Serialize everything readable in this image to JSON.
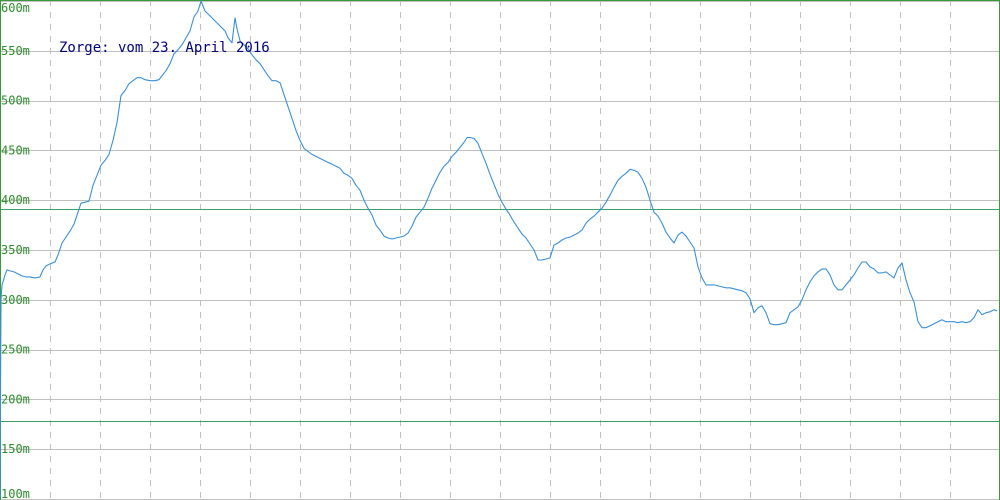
{
  "colors": {
    "background": "#ffffff",
    "grid": "#c0c0c0",
    "frame": "#3a9a3a",
    "tick_labels": "#2e8b2e",
    "reference_lines": "#3aa06a",
    "series": "#3b8fd6",
    "title": "#00007a"
  },
  "chart_data": {
    "type": "line",
    "title": "Zorge: vom 23. April 2016",
    "xlabel": "",
    "ylabel": "",
    "ylim": [
      100,
      600
    ],
    "x_grid_count": 20,
    "grid": true,
    "yticks": [
      {
        "value": 600,
        "label": "600m"
      },
      {
        "value": 550,
        "label": "550m"
      },
      {
        "value": 500,
        "label": "500m"
      },
      {
        "value": 450,
        "label": "450m"
      },
      {
        "value": 400,
        "label": "400m"
      },
      {
        "value": 350,
        "label": "350m"
      },
      {
        "value": 300,
        "label": "300m"
      },
      {
        "value": 250,
        "label": "250m"
      },
      {
        "value": 200,
        "label": "200m"
      },
      {
        "value": 150,
        "label": "150m"
      },
      {
        "value": 100,
        "label": "100m"
      }
    ],
    "reference_lines": [
      391,
      178
    ],
    "series": [
      {
        "values": [
          [
            0,
            100
          ],
          [
            0.5,
            210
          ],
          [
            1,
            300
          ],
          [
            2,
            315
          ],
          [
            3,
            318
          ],
          [
            5,
            325
          ],
          [
            7,
            330
          ],
          [
            10,
            329
          ],
          [
            14,
            328
          ],
          [
            18,
            326
          ],
          [
            22,
            324
          ],
          [
            26,
            323
          ],
          [
            30,
            323
          ],
          [
            35,
            322
          ],
          [
            40,
            323
          ],
          [
            43,
            330
          ],
          [
            46,
            334
          ],
          [
            50,
            336
          ],
          [
            55,
            338
          ],
          [
            58,
            345
          ],
          [
            62,
            357
          ],
          [
            66,
            363
          ],
          [
            70,
            369
          ],
          [
            74,
            376
          ],
          [
            78,
            388
          ],
          [
            81,
            397
          ],
          [
            85,
            398
          ],
          [
            89,
            399
          ],
          [
            93,
            415
          ],
          [
            97,
            425
          ],
          [
            101,
            435
          ],
          [
            105,
            440
          ],
          [
            109,
            446
          ],
          [
            113,
            460
          ],
          [
            117,
            478
          ],
          [
            121,
            505
          ],
          [
            125,
            510
          ],
          [
            129,
            517
          ],
          [
            133,
            520
          ],
          [
            137,
            523
          ],
          [
            141,
            523
          ],
          [
            145,
            521
          ],
          [
            150,
            520
          ],
          [
            155,
            520
          ],
          [
            159,
            521
          ],
          [
            162,
            525
          ],
          [
            166,
            530
          ],
          [
            170,
            537
          ],
          [
            174,
            547
          ],
          [
            178,
            551
          ],
          [
            182,
            556
          ],
          [
            186,
            563
          ],
          [
            190,
            570
          ],
          [
            194,
            584
          ],
          [
            198,
            590
          ],
          [
            201,
            600
          ],
          [
            205,
            590
          ],
          [
            210,
            585
          ],
          [
            215,
            580
          ],
          [
            220,
            575
          ],
          [
            225,
            570
          ],
          [
            228,
            563
          ],
          [
            232,
            558
          ],
          [
            235,
            583
          ],
          [
            237,
            572
          ],
          [
            240,
            560
          ],
          [
            244,
            556
          ],
          [
            248,
            552
          ],
          [
            252,
            546
          ],
          [
            256,
            541
          ],
          [
            260,
            537
          ],
          [
            264,
            531
          ],
          [
            268,
            525
          ],
          [
            272,
            520
          ],
          [
            276,
            520
          ],
          [
            280,
            518
          ],
          [
            284,
            506
          ],
          [
            288,
            494
          ],
          [
            292,
            482
          ],
          [
            296,
            470
          ],
          [
            300,
            460
          ],
          [
            304,
            452
          ],
          [
            308,
            449
          ],
          [
            312,
            446
          ],
          [
            316,
            444
          ],
          [
            320,
            442
          ],
          [
            324,
            440
          ],
          [
            328,
            438
          ],
          [
            332,
            436
          ],
          [
            336,
            434
          ],
          [
            340,
            432
          ],
          [
            344,
            427
          ],
          [
            348,
            425
          ],
          [
            352,
            422
          ],
          [
            356,
            415
          ],
          [
            360,
            410
          ],
          [
            364,
            400
          ],
          [
            368,
            392
          ],
          [
            372,
            385
          ],
          [
            376,
            375
          ],
          [
            380,
            370
          ],
          [
            384,
            364
          ],
          [
            388,
            362
          ],
          [
            392,
            361
          ],
          [
            396,
            362
          ],
          [
            400,
            363
          ],
          [
            404,
            364
          ],
          [
            408,
            367
          ],
          [
            412,
            374
          ],
          [
            416,
            383
          ],
          [
            420,
            388
          ],
          [
            424,
            393
          ],
          [
            428,
            402
          ],
          [
            432,
            412
          ],
          [
            436,
            420
          ],
          [
            440,
            428
          ],
          [
            444,
            434
          ],
          [
            448,
            438
          ],
          [
            452,
            444
          ],
          [
            456,
            448
          ],
          [
            460,
            453
          ],
          [
            464,
            458
          ],
          [
            467,
            463
          ],
          [
            470,
            463
          ],
          [
            474,
            462
          ],
          [
            478,
            457
          ],
          [
            482,
            447
          ],
          [
            486,
            437
          ],
          [
            490,
            426
          ],
          [
            494,
            416
          ],
          [
            498,
            406
          ],
          [
            502,
            398
          ],
          [
            506,
            391
          ],
          [
            510,
            385
          ],
          [
            514,
            378
          ],
          [
            518,
            372
          ],
          [
            522,
            366
          ],
          [
            526,
            362
          ],
          [
            530,
            356
          ],
          [
            534,
            350
          ],
          [
            538,
            340
          ],
          [
            542,
            340
          ],
          [
            546,
            341
          ],
          [
            550,
            342
          ],
          [
            554,
            355
          ],
          [
            558,
            357
          ],
          [
            562,
            360
          ],
          [
            566,
            362
          ],
          [
            570,
            363
          ],
          [
            574,
            365
          ],
          [
            578,
            367
          ],
          [
            582,
            370
          ],
          [
            586,
            377
          ],
          [
            590,
            381
          ],
          [
            594,
            384
          ],
          [
            598,
            388
          ],
          [
            602,
            392
          ],
          [
            606,
            398
          ],
          [
            610,
            405
          ],
          [
            614,
            413
          ],
          [
            618,
            420
          ],
          [
            622,
            424
          ],
          [
            626,
            427
          ],
          [
            630,
            431
          ],
          [
            634,
            430
          ],
          [
            638,
            428
          ],
          [
            642,
            422
          ],
          [
            646,
            413
          ],
          [
            650,
            400
          ],
          [
            654,
            388
          ],
          [
            658,
            384
          ],
          [
            662,
            377
          ],
          [
            666,
            368
          ],
          [
            670,
            362
          ],
          [
            674,
            357
          ],
          [
            678,
            365
          ],
          [
            682,
            368
          ],
          [
            686,
            364
          ],
          [
            690,
            358
          ],
          [
            694,
            352
          ],
          [
            698,
            333
          ],
          [
            702,
            322
          ],
          [
            706,
            315
          ],
          [
            710,
            315
          ],
          [
            714,
            315
          ],
          [
            718,
            314
          ],
          [
            722,
            313
          ],
          [
            726,
            312
          ],
          [
            730,
            312
          ],
          [
            734,
            311
          ],
          [
            738,
            310
          ],
          [
            742,
            309
          ],
          [
            746,
            307
          ],
          [
            750,
            301
          ],
          [
            754,
            287
          ],
          [
            758,
            292
          ],
          [
            762,
            294
          ],
          [
            766,
            287
          ],
          [
            770,
            276
          ],
          [
            774,
            275
          ],
          [
            778,
            275
          ],
          [
            782,
            276
          ],
          [
            786,
            277
          ],
          [
            790,
            287
          ],
          [
            794,
            290
          ],
          [
            798,
            293
          ],
          [
            802,
            300
          ],
          [
            806,
            310
          ],
          [
            810,
            318
          ],
          [
            814,
            324
          ],
          [
            818,
            328
          ],
          [
            822,
            331
          ],
          [
            826,
            331
          ],
          [
            830,
            325
          ],
          [
            834,
            315
          ],
          [
            838,
            310
          ],
          [
            842,
            310
          ],
          [
            846,
            315
          ],
          [
            850,
            320
          ],
          [
            854,
            325
          ],
          [
            858,
            332
          ],
          [
            862,
            338
          ],
          [
            866,
            338
          ],
          [
            870,
            333
          ],
          [
            874,
            331
          ],
          [
            878,
            327
          ],
          [
            882,
            327
          ],
          [
            886,
            328
          ],
          [
            890,
            325
          ],
          [
            894,
            322
          ],
          [
            898,
            332
          ],
          [
            902,
            337
          ],
          [
            906,
            320
          ],
          [
            910,
            307
          ],
          [
            914,
            298
          ],
          [
            918,
            278
          ],
          [
            922,
            272
          ],
          [
            926,
            272
          ],
          [
            930,
            274
          ],
          [
            934,
            276
          ],
          [
            938,
            278
          ],
          [
            942,
            280
          ],
          [
            946,
            278
          ],
          [
            950,
            278
          ],
          [
            954,
            278
          ],
          [
            958,
            277
          ],
          [
            962,
            278
          ],
          [
            966,
            277
          ],
          [
            970,
            278
          ],
          [
            974,
            282
          ],
          [
            978,
            290
          ],
          [
            982,
            285
          ],
          [
            986,
            287
          ],
          [
            990,
            288
          ],
          [
            994,
            290
          ],
          [
            997,
            289
          ]
        ]
      }
    ]
  }
}
